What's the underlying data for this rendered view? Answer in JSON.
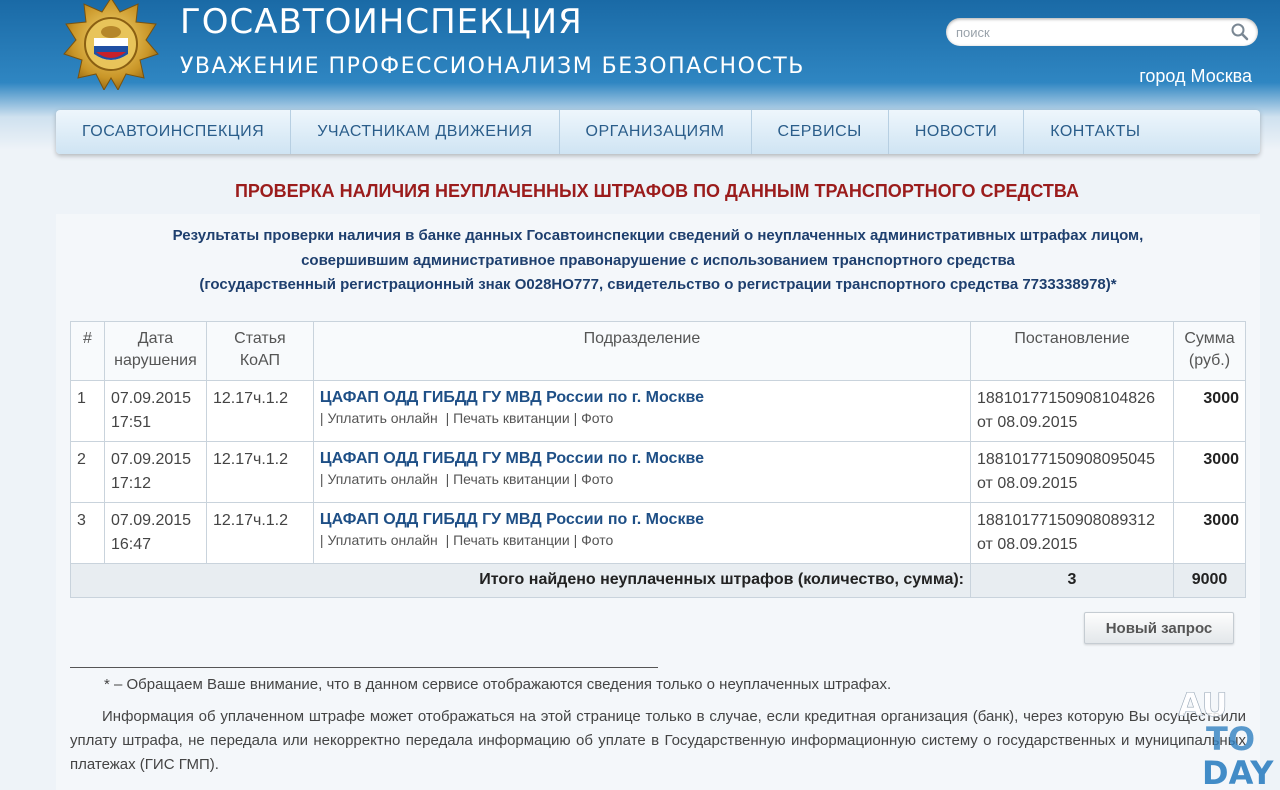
{
  "header": {
    "title": "ГОСАВТОИНСПЕКЦИЯ",
    "tagline": "УВАЖЕНИЕ  ПРОФЕССИОНАЛИЗМ  БЕЗОПАСНОСТЬ",
    "search_placeholder": "поиск",
    "city": "город Москва"
  },
  "nav": {
    "items": [
      {
        "label": "ГОСАВТОИНСПЕКЦИЯ"
      },
      {
        "label": "УЧАСТНИКАМ ДВИЖЕНИЯ"
      },
      {
        "label": "ОРГАНИЗАЦИЯМ"
      },
      {
        "label": "СЕРВИСЫ"
      },
      {
        "label": "НОВОСТИ"
      },
      {
        "label": "КОНТАКТЫ"
      }
    ]
  },
  "page": {
    "title": "ПРОВЕРКА НАЛИЧИЯ НЕУПЛАЧЕННЫХ ШТРАФОВ ПО ДАННЫМ ТРАНСПОРТНОГО СРЕДСТВА",
    "intro_line1": "Результаты проверки наличия в банке данных Госавтоинспекции сведений о неуплаченных административных штрафах лицом,",
    "intro_line2": "совершившим административное правонарушение с использованием транспортного средства",
    "intro_line3": "(государственный регистрационный знак О028НО777, свидетельство о регистрации транспортного средства 7733338978)*"
  },
  "table": {
    "headers": {
      "num": "#",
      "date_1": "Дата",
      "date_2": "нарушения",
      "article_1": "Статья",
      "article_2": "КоАП",
      "department": "Подразделение",
      "resolution": "Постановление",
      "sum_1": "Сумма",
      "sum_2": "(руб.)"
    },
    "rows": [
      {
        "num": "1",
        "date": "07.09.2015",
        "time": "17:51",
        "article": "12.17ч.1.2",
        "department": "ЦАФАП ОДД ГИБДД ГУ МВД России по г. Москве",
        "link_pay": "Уплатить онлайн",
        "link_print": "Печать квитанции",
        "link_photo": "Фото",
        "resolution_number": "18810177150908104826",
        "resolution_date": "от 08.09.2015",
        "amount": "3000"
      },
      {
        "num": "2",
        "date": "07.09.2015",
        "time": "17:12",
        "article": "12.17ч.1.2",
        "department": "ЦАФАП ОДД ГИБДД ГУ МВД России по г. Москве",
        "link_pay": "Уплатить онлайн",
        "link_print": "Печать квитанции",
        "link_photo": "Фото",
        "resolution_number": "18810177150908095045",
        "resolution_date": "от 08.09.2015",
        "amount": "3000"
      },
      {
        "num": "3",
        "date": "07.09.2015",
        "time": "16:47",
        "article": "12.17ч.1.2",
        "department": "ЦАФАП ОДД ГИБДД ГУ МВД России по г. Москве",
        "link_pay": "Уплатить онлайн",
        "link_print": "Печать квитанции",
        "link_photo": "Фото",
        "resolution_number": "18810177150908089312",
        "resolution_date": "от 08.09.2015",
        "amount": "3000"
      }
    ],
    "total_label": "Итого найдено неуплаченных штрафов (количество, сумма):",
    "total_count": "3",
    "total_sum": "9000"
  },
  "actions": {
    "new_request": "Новый запрос"
  },
  "footer": {
    "footnote": "* – Обращаем Ваше внимание, что в данном сервисе отображаются сведения только о неуплаченных штрафах.",
    "info": "Информация об уплаченном штрафе может отображаться на этой странице только в случае, если кредитная организация (банк), через которую Вы осуществили уплату штрафа, не передала или некорректно передала информацию об уплате в Государственную информационную систему о государственных и муниципальных платежах (ГИС ГМП)."
  },
  "watermark": {
    "line1": "AU",
    "line2": "TO",
    "line3": "DAY"
  },
  "icons": {
    "emblem": "gibdd-emblem-icon",
    "search": "search-icon"
  },
  "colors": {
    "header_blue": "#1a6aa6",
    "title_red": "#9b1c1c",
    "link_blue": "#1e4f86"
  }
}
